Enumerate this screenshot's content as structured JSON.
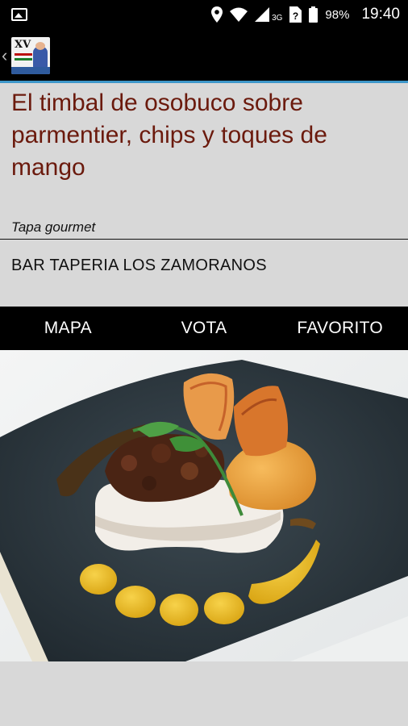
{
  "status_bar": {
    "network": "3G",
    "battery": "98%",
    "time": "19:40",
    "icons": [
      "image-icon",
      "location-icon",
      "wifi-icon",
      "signal-icon",
      "sim-unknown-icon",
      "battery-icon"
    ]
  },
  "app_bar": {
    "logo_text": "XV"
  },
  "dish": {
    "title": "El timbal de osobuco sobre parmentier, chips y toques de mango",
    "category": "Tapa gourmet",
    "bar": "BAR TAPERIA LOS ZAMORANOS"
  },
  "tabs": [
    {
      "label": "MAPA"
    },
    {
      "label": "VOTA"
    },
    {
      "label": "FAVORITO"
    }
  ],
  "colors": {
    "title": "#6b1a0d",
    "accent": "#3d97c9",
    "background": "#d8d8d8"
  }
}
